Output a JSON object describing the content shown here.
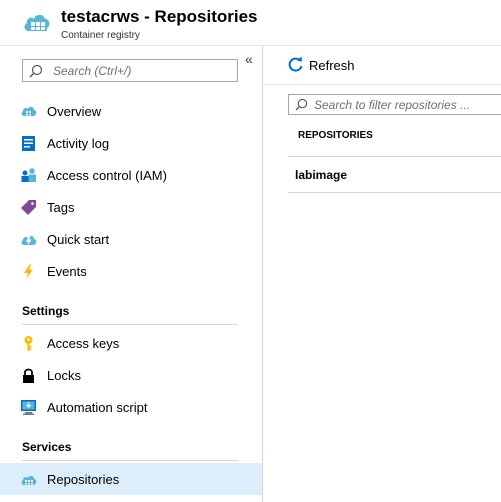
{
  "header": {
    "title": "testacrws - Repositories",
    "subtitle": "Container registry",
    "logo_icon": "container-registry-cloud-icon"
  },
  "sidebar": {
    "search_placeholder": "Search (Ctrl+/)",
    "collapse_glyph": "«",
    "items": [
      {
        "label": "Overview",
        "icon": "overview-cloud-icon"
      },
      {
        "label": "Activity log",
        "icon": "activity-log-icon"
      },
      {
        "label": "Access control (IAM)",
        "icon": "users-icon"
      },
      {
        "label": "Tags",
        "icon": "tag-icon"
      },
      {
        "label": "Quick start",
        "icon": "quick-start-cloud-icon"
      },
      {
        "label": "Events",
        "icon": "lightning-icon"
      }
    ],
    "settings": {
      "heading": "Settings",
      "items": [
        {
          "label": "Access keys",
          "icon": "key-icon"
        },
        {
          "label": "Locks",
          "icon": "lock-icon"
        },
        {
          "label": "Automation script",
          "icon": "automation-script-icon"
        }
      ]
    },
    "services": {
      "heading": "Services",
      "items": [
        {
          "label": "Repositories",
          "icon": "repositories-icon",
          "active": true
        }
      ]
    }
  },
  "main": {
    "toolbar": {
      "refresh_label": "Refresh"
    },
    "filter_placeholder": "Search to filter repositories ...",
    "table": {
      "column": "REPOSITORIES",
      "rows": [
        "labimage"
      ]
    }
  },
  "colors": {
    "accent": "#0072c6",
    "active_bg": "#dceefc",
    "border": "#d6d6d6"
  }
}
